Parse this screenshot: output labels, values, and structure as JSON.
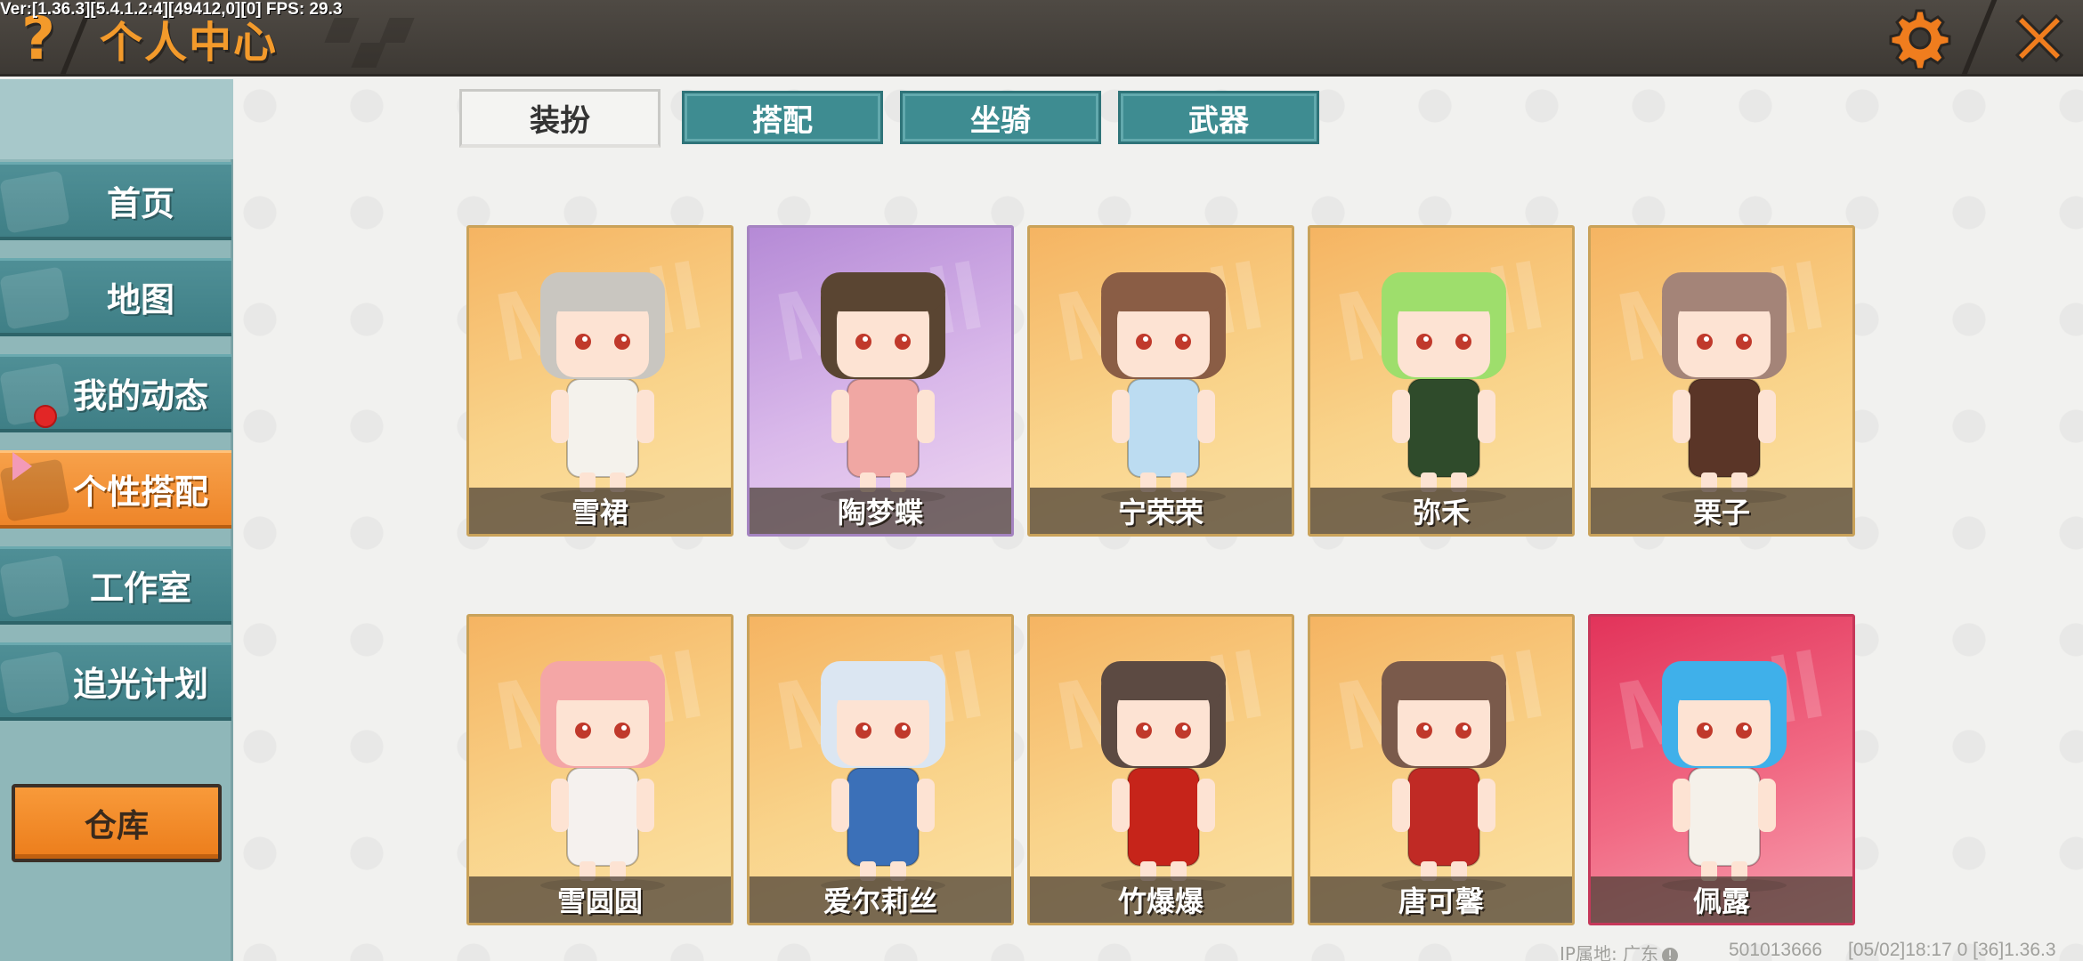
{
  "debug_text": "Ver:[1.36.3][5.4.1.2:4][49412,0][0] FPS: 29.3",
  "header": {
    "help_icon": "question-mark-icon",
    "title": "个人中心",
    "settings_icon": "gear-icon",
    "close_icon": "close-icon",
    "accent_color": "#f39a2b"
  },
  "sidebar": {
    "items": [
      {
        "label": "首页",
        "active": false
      },
      {
        "label": "地图",
        "active": false
      },
      {
        "label": "我的动态",
        "active": false,
        "notification": true
      },
      {
        "label": "个性搭配",
        "active": true
      },
      {
        "label": "工作室",
        "active": false
      },
      {
        "label": "追光计划",
        "active": false
      }
    ],
    "warehouse_label": "仓库"
  },
  "tabs": [
    {
      "label": "装扮",
      "active": true
    },
    {
      "label": "搭配",
      "active": false
    },
    {
      "label": "坐骑",
      "active": false
    },
    {
      "label": "武器",
      "active": false
    }
  ],
  "skins": [
    {
      "name": "雪裙",
      "theme": "gold",
      "hair": "#c9c6c0",
      "outfit": "#f4f2ec"
    },
    {
      "name": "陶梦蝶",
      "theme": "purple",
      "hair": "#5a4532",
      "outfit": "#f0a7a3"
    },
    {
      "name": "宁荣荣",
      "theme": "gold",
      "hair": "#8a5d45",
      "outfit": "#bcdcf1"
    },
    {
      "name": "弥禾",
      "theme": "gold",
      "hair": "#9ede6c",
      "outfit": "#2f4b2b"
    },
    {
      "name": "栗子",
      "theme": "gold",
      "hair": "#a48478",
      "outfit": "#5a3527"
    },
    {
      "name": "雪圆圆",
      "theme": "gold",
      "hair": "#f4a6a6",
      "outfit": "#f5f1ee"
    },
    {
      "name": "爱尔莉丝",
      "theme": "gold",
      "hair": "#dbe6f2",
      "outfit": "#3b70b8"
    },
    {
      "name": "竹爆爆",
      "theme": "gold",
      "hair": "#5c4a42",
      "outfit": "#c6241a"
    },
    {
      "name": "唐可馨",
      "theme": "gold",
      "hair": "#7a5a4b",
      "outfit": "#c02a25"
    },
    {
      "name": "佩露",
      "theme": "pink",
      "hair": "#3fb0ea",
      "outfit": "#f5f1ea"
    }
  ],
  "card_watermark": "MINI",
  "footer": {
    "ip_location": "IP属地: 广东",
    "uid": "501013666",
    "build": "[05/02]18:17 0  [36]1.36.3"
  }
}
